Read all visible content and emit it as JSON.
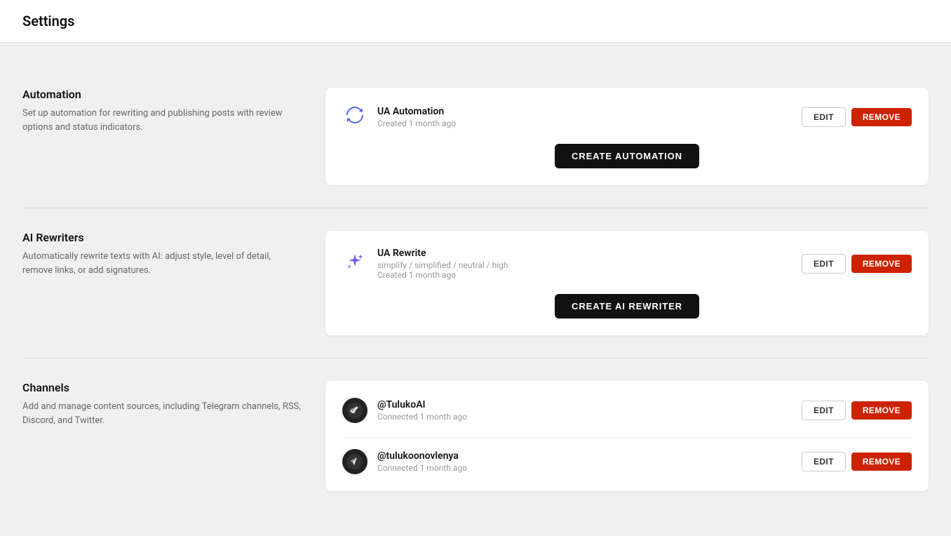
{
  "page": {
    "title": "Settings"
  },
  "automation": {
    "section_title": "Automation",
    "section_description": "Set up automation for rewriting and publishing posts with review options and status indicators.",
    "items": [
      {
        "name": "UA Automation",
        "subtitle": "Created 1 month ago"
      }
    ],
    "edit_label": "EDIT",
    "remove_label": "REMOVE",
    "create_label": "CREATE AUTOMATION"
  },
  "ai_rewriters": {
    "section_title": "AI Rewriters",
    "section_description": "Automatically rewrite texts with AI: adjust style, level of detail, remove links, or add signatures.",
    "items": [
      {
        "name": "UA Rewrite",
        "subtitle_line1": "simplify / simplified / neutral / high",
        "subtitle_line2": "Created 1 month ago"
      }
    ],
    "edit_label": "EDIT",
    "remove_label": "REMOVE",
    "create_label": "CREATE AI REWRITER"
  },
  "channels": {
    "section_title": "Channels",
    "section_description": "Add and manage content sources, including Telegram channels, RSS, Discord, and Twitter.",
    "items": [
      {
        "name": "@TulukoAI",
        "subtitle": "Connected 1 month ago"
      },
      {
        "name": "@tulukoonovlenya",
        "subtitle": "Connected 1 month ago"
      }
    ],
    "edit_label": "EDIT",
    "remove_label": "REMOVE"
  }
}
